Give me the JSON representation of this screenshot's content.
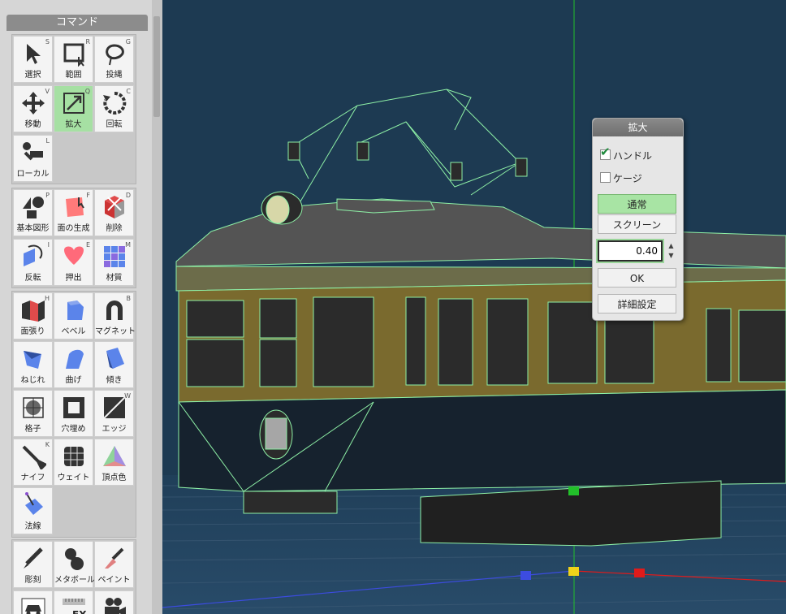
{
  "command_panel": {
    "title": "コマンド",
    "groups": [
      [
        {
          "name": "select",
          "label": "選択",
          "key": "S",
          "icon": "arrow-cursor-icon"
        },
        {
          "name": "range",
          "label": "範囲",
          "key": "R",
          "icon": "rectangle-select-icon"
        },
        {
          "name": "lasso",
          "label": "投縄",
          "key": "G",
          "icon": "lasso-icon"
        },
        {
          "name": "move",
          "label": "移動",
          "key": "V",
          "icon": "move-arrows-icon"
        },
        {
          "name": "scale",
          "label": "拡大",
          "key": "Q",
          "icon": "scale-icon",
          "active": true
        },
        {
          "name": "rotate",
          "label": "回転",
          "key": "C",
          "icon": "rotate-icon"
        },
        {
          "name": "local",
          "label": "ローカル",
          "key": "L",
          "icon": "local-icon"
        }
      ],
      [
        {
          "name": "basic-shape",
          "label": "基本図形",
          "key": "P",
          "icon": "shapes-icon"
        },
        {
          "name": "create-face",
          "label": "面の生成",
          "key": "F",
          "icon": "create-face-icon"
        },
        {
          "name": "delete",
          "label": "削除",
          "key": "D",
          "icon": "delete-icon"
        },
        {
          "name": "flip",
          "label": "反転",
          "key": "I",
          "icon": "flip-icon"
        },
        {
          "name": "extrude",
          "label": "押出",
          "key": "E",
          "icon": "extrude-icon"
        },
        {
          "name": "material",
          "label": "材質",
          "key": "M",
          "icon": "material-icon"
        }
      ],
      [
        {
          "name": "face-paste",
          "label": "面張り",
          "key": "H",
          "icon": "face-paste-icon"
        },
        {
          "name": "bevel",
          "label": "ベベル",
          "key": "",
          "icon": "bevel-icon"
        },
        {
          "name": "magnet",
          "label": "マグネット",
          "key": "B",
          "icon": "magnet-icon"
        },
        {
          "name": "twist",
          "label": "ねじれ",
          "key": "",
          "icon": "twist-icon"
        },
        {
          "name": "bend",
          "label": "曲げ",
          "key": "",
          "icon": "bend-icon"
        },
        {
          "name": "tilt",
          "label": "傾き",
          "key": "",
          "icon": "tilt-icon"
        },
        {
          "name": "lattice",
          "label": "格子",
          "key": "",
          "icon": "lattice-icon"
        },
        {
          "name": "fill-hole",
          "label": "穴埋め",
          "key": "",
          "icon": "fill-hole-icon"
        },
        {
          "name": "edge",
          "label": "エッジ",
          "key": "W",
          "icon": "edge-icon"
        },
        {
          "name": "knife",
          "label": "ナイフ",
          "key": "K",
          "icon": "knife-icon"
        },
        {
          "name": "weight",
          "label": "ウェイト",
          "key": "",
          "icon": "weight-icon"
        },
        {
          "name": "vertex-color",
          "label": "頂点色",
          "key": "",
          "icon": "vertex-color-icon"
        },
        {
          "name": "normal",
          "label": "法線",
          "key": "",
          "icon": "normal-icon"
        }
      ],
      [
        {
          "name": "sculpt",
          "label": "彫刻",
          "key": "",
          "icon": "sculpt-icon"
        },
        {
          "name": "metaball",
          "label": "メタボール",
          "key": "",
          "icon": "metaball-icon"
        },
        {
          "name": "paint",
          "label": "ペイント",
          "key": "",
          "icon": "paint-icon"
        },
        {
          "name": "car",
          "label": "",
          "key": "",
          "icon": "car-icon"
        },
        {
          "name": "ruler",
          "label": "",
          "key": "",
          "icon": "ruler-fx-icon"
        },
        {
          "name": "camera",
          "label": "",
          "key": "",
          "icon": "movie-camera-icon"
        }
      ]
    ]
  },
  "scale_dialog": {
    "title": "拡大",
    "handle": {
      "label": "ハンドル",
      "checked": true
    },
    "gauge": {
      "label": "ケージ",
      "checked": false
    },
    "mode_normal": "通常",
    "mode_screen": "スクリーン",
    "selected_mode": "通常",
    "value": "0.40",
    "ok": "OK",
    "details": "詳細設定"
  },
  "colors": {
    "sidebar_bg": "#d6d6d6",
    "viewport_bg": "#1d3a52",
    "wire": "#8ef0a6",
    "accent_green": "#a6e0a3",
    "body_wood": "#7a6a2e",
    "axis_x": "#e01b1b",
    "axis_y": "#22c02a",
    "axis_z": "#3c4ce0",
    "handle_center": "#f0d21a"
  }
}
